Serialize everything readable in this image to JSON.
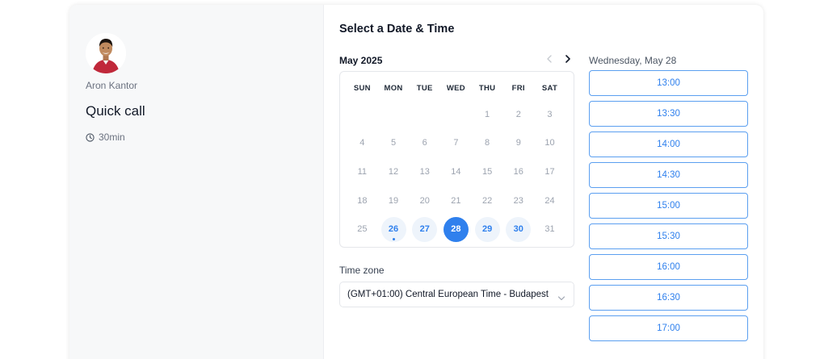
{
  "host": {
    "name": "Aron Kantor"
  },
  "event": {
    "title": "Quick call",
    "duration": "30min",
    "duration_icon": "clock-icon"
  },
  "scheduler": {
    "title": "Select a Date & Time",
    "month_label": "May 2025",
    "weekdays": [
      "SUN",
      "MON",
      "TUE",
      "WED",
      "THU",
      "FRI",
      "SAT"
    ],
    "weeks": [
      [
        "",
        "",
        "",
        "",
        "1",
        "2",
        "3"
      ],
      [
        "4",
        "5",
        "6",
        "7",
        "8",
        "9",
        "10"
      ],
      [
        "11",
        "12",
        "13",
        "14",
        "15",
        "16",
        "17"
      ],
      [
        "18",
        "19",
        "20",
        "21",
        "22",
        "23",
        "24"
      ],
      [
        "25",
        "26",
        "27",
        "28",
        "29",
        "30",
        "31"
      ]
    ],
    "available_days": [
      "26",
      "27",
      "28",
      "29",
      "30"
    ],
    "selected_day": "28",
    "today_day": "26",
    "timezone_label": "Time zone",
    "timezone_value": "(GMT+01:00) Central European Time - Budapest",
    "selected_date_heading": "Wednesday, May 28",
    "time_slots": [
      "13:00",
      "13:30",
      "14:00",
      "14:30",
      "15:00",
      "15:30",
      "16:00",
      "16:30",
      "17:00"
    ]
  },
  "colors": {
    "accent": "#2f80ed",
    "available_bg": "#eef4fb",
    "muted_day": "#9ca3af",
    "left_panel_bg": "#f7f8f9"
  }
}
